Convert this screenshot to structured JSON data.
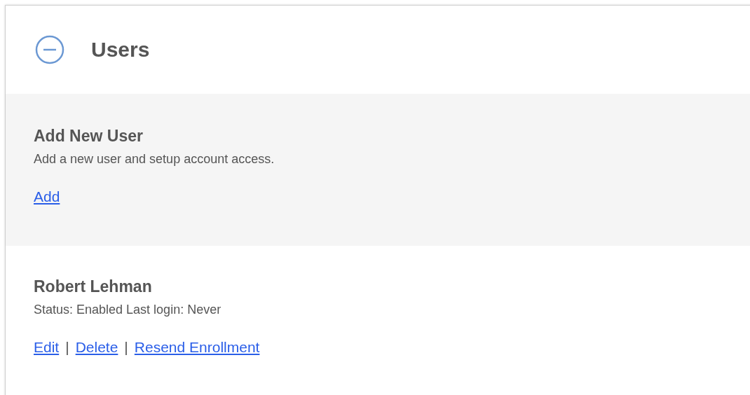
{
  "panel": {
    "title": "Users",
    "expanded": true
  },
  "add_section": {
    "title": "Add New User",
    "description": "Add a new user and setup account access.",
    "link": "Add"
  },
  "users": [
    {
      "name": "Robert Lehman",
      "status": "Status: Enabled Last login: Never",
      "actions": [
        "Edit",
        "Delete",
        "Resend Enrollment"
      ],
      "separators": [
        "|",
        "|"
      ]
    }
  ]
}
